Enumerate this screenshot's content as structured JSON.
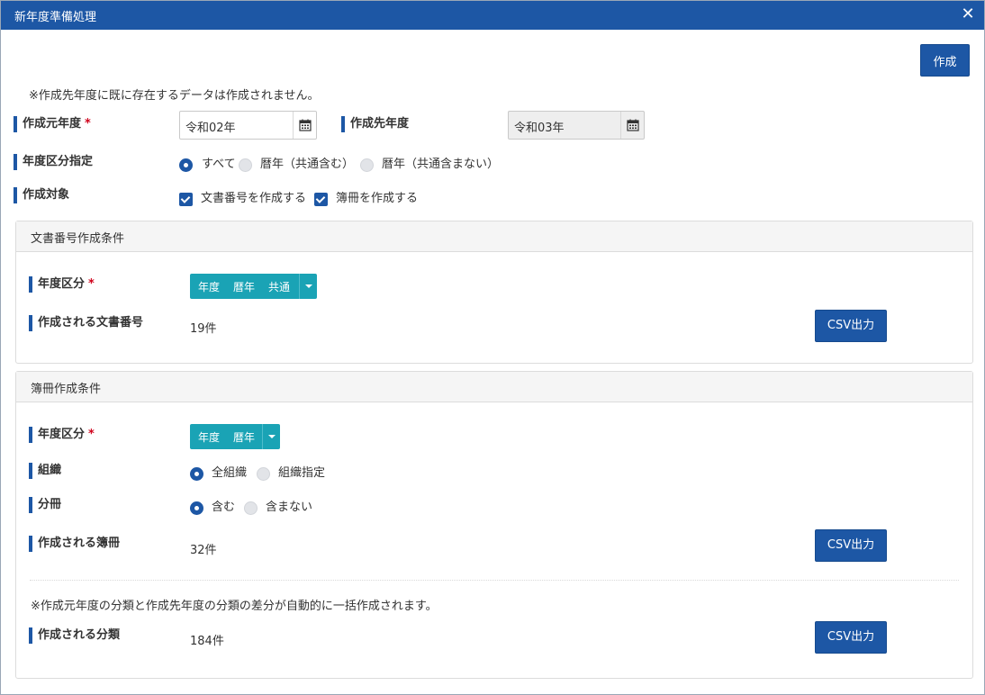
{
  "dialog": {
    "title": "新年度準備処理",
    "create_button": "作成",
    "note": "※作成先年度に既に存在するデータは作成されません。"
  },
  "source_year": {
    "label": "作成元年度",
    "required_mark": "*",
    "value": "令和02年"
  },
  "target_year": {
    "label": "作成先年度",
    "value": "令和03年"
  },
  "year_type": {
    "label": "年度区分指定",
    "options": [
      "すべて",
      "暦年（共通含む）",
      "暦年（共通含まない）"
    ],
    "selected": "すべて"
  },
  "targets": {
    "label": "作成対象",
    "options": [
      "文書番号を作成する",
      "簿冊を作成する"
    ]
  },
  "doc_panel": {
    "title": "文書番号作成条件",
    "year_type_label": "年度区分",
    "required_mark": "*",
    "year_type_values": [
      "年度",
      "暦年",
      "共通"
    ],
    "count_label": "作成される文書番号",
    "count_value": "19件",
    "csv_button": "CSV出力"
  },
  "book_panel": {
    "title": "簿冊作成条件",
    "year_type_label": "年度区分",
    "required_mark": "*",
    "year_type_values": [
      "年度",
      "暦年"
    ],
    "org_label": "組織",
    "org_options": [
      "全組織",
      "組織指定"
    ],
    "org_selected": "全組織",
    "split_label": "分冊",
    "split_options": [
      "含む",
      "含まない"
    ],
    "split_selected": "含む",
    "count_label": "作成される簿冊",
    "count_value": "32件",
    "csv_button": "CSV出力",
    "class_note": "※作成元年度の分類と作成先年度の分類の差分が自動的に一括作成されます。",
    "class_label": "作成される分類",
    "class_value": "184件",
    "class_csv_button": "CSV出力"
  },
  "icons": {
    "calendar": "calendar-icon",
    "close": "close-icon",
    "caret": "chevron-down-icon"
  },
  "colors": {
    "primary": "#1d57a5",
    "multiselect": "#1aa3b5",
    "required": "#d0021b"
  }
}
